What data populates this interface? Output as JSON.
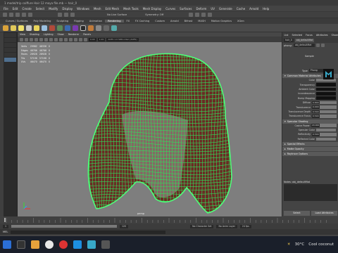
{
  "window": {
    "title": "1 model/trip coiffure Hair 12 maya file.mb  —  hair_0"
  },
  "menubar": [
    "File",
    "Edit",
    "Create",
    "Select",
    "Modify",
    "Display",
    "Windows",
    "Mesh",
    "Edit Mesh",
    "Mesh Tools",
    "Mesh Display",
    "Curves",
    "Surfaces",
    "Deform",
    "UV",
    "Generate",
    "Cache",
    "Arnold",
    "Help"
  ],
  "status": {
    "live_surface": "No Live Surface",
    "symmetry": "Symmetry: Off"
  },
  "shelf_tabs": [
    "Curves / Surfaces",
    "Poly Modeling",
    "Sculpting",
    "Rigging",
    "Animation",
    "Rendering",
    "FX",
    "FX Caching",
    "Custom",
    "Arnold",
    "Bifrost",
    "MASH",
    "Motion Graphics",
    "XGen"
  ],
  "shelf_active": "Rendering",
  "viewport": {
    "menus": [
      "View",
      "Shading",
      "Lighting",
      "Show",
      "Renderer",
      "Panels"
    ],
    "gamma_field": "ACES 1.0 SDR-video (ACES)",
    "exposure": "0.00",
    "gamma": "1.00",
    "camera_label": "persp",
    "hud": {
      "columns": [
        "",
        "",
        "",
        ""
      ],
      "rows": [
        {
          "label": "Verts",
          "a": "29982",
          "b": "48336",
          "c": "0"
        },
        {
          "label": "Edges",
          "a": "48786",
          "b": "48786",
          "c": "0"
        },
        {
          "label": "Faces",
          "a": "28928",
          "b": "28928",
          "c": "0"
        },
        {
          "label": "Tris",
          "a": "57196",
          "b": "57196",
          "c": "0"
        },
        {
          "label": "UVs",
          "a": "46470",
          "b": "46470",
          "c": "0"
        }
      ]
    },
    "wire_color": "#2fe05a",
    "fill_color": "#6b2b24"
  },
  "attribute_editor": {
    "tabs": [
      "List",
      "Selected",
      "Focus",
      "Attributes",
      "Show",
      "Help"
    ],
    "node_tab": "hair_0",
    "material_tab": "obj_defaultMat",
    "material_label": "phong:",
    "material_name": "obj_defaultMat",
    "sample_label": "Sample",
    "type_label": "Type",
    "type_value": "Phong",
    "sections": {
      "common": "Common Material Attributes",
      "specular": "Specular Shading",
      "special": "Special Effects",
      "matte": "Matte Opacity",
      "raytrace": "Raytrace Options"
    },
    "common_props": [
      "Color",
      "Transparency",
      "Ambient Color",
      "Incandescence",
      "Bump Mapping",
      "Diffuse",
      "Translucence",
      "Translucence Depth",
      "Translucence Focus"
    ],
    "common_values": [
      "",
      "",
      "",
      "",
      "",
      "0.800",
      "0.000",
      "0.500",
      "0.500"
    ],
    "specular_props": [
      "Cosine Power",
      "Specular Color",
      "Reflectivity",
      "Reflected Color"
    ],
    "specular_values": [
      "20.000",
      "",
      "0.500",
      ""
    ],
    "notes_label": "Notes:  obj_defaultMat",
    "select_button": "Select",
    "load_button": "Load Attributes"
  },
  "timeline": {
    "start": "1",
    "end": "120",
    "no_character": "No Character Set",
    "no_anim_layer": "No Anim Layer",
    "fps": "24 fps"
  },
  "command": {
    "label": "MEL"
  },
  "taskbar": {
    "weather": "30°C",
    "weather_text": "Cool coconut"
  },
  "colors": {
    "maya_blue": "#38a9c9",
    "selection": "#4f6f8f"
  }
}
